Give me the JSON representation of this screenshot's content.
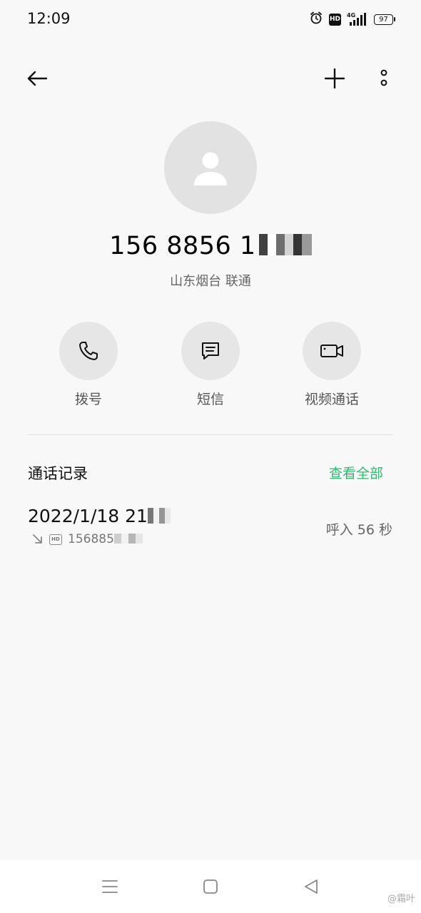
{
  "status_bar": {
    "time": "12:09",
    "hd_label": "HD",
    "network_label": "4G",
    "battery_level": "97"
  },
  "contact": {
    "phone_number_visible": "156 8856 1",
    "location_carrier": "山东烟台 联通"
  },
  "actions": [
    {
      "id": "call",
      "label": "拨号",
      "icon": "phone-icon"
    },
    {
      "id": "sms",
      "label": "短信",
      "icon": "message-icon"
    },
    {
      "id": "video",
      "label": "视频通话",
      "icon": "video-icon"
    }
  ],
  "call_log": {
    "title": "通话记录",
    "view_all_label": "查看全部",
    "entry": {
      "datetime_visible": "2022/1/18 21",
      "hd_label": "HD",
      "number_visible": "156885",
      "status": "呼入  56 秒"
    }
  },
  "watermark": "@霜叶",
  "colors": {
    "accent_green": "#2dbd6e",
    "background": "#f8f8f8",
    "avatar_bg": "#e2e2e2",
    "action_bg": "#e6e6e6"
  }
}
